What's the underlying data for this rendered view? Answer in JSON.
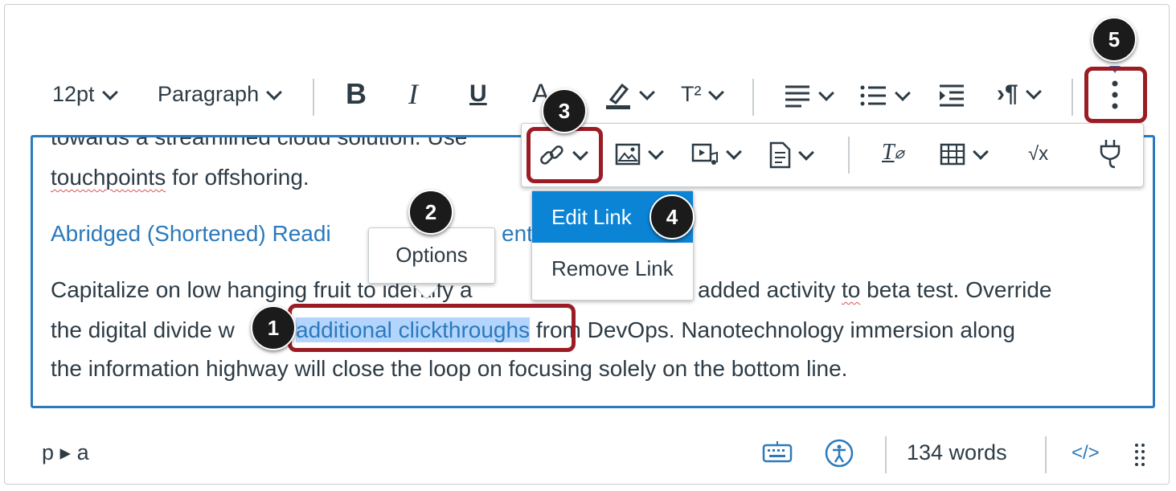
{
  "toolbar": {
    "font_size": "12pt",
    "block_format": "Paragraph",
    "bold_glyph": "B",
    "italic_glyph": "I",
    "underline_glyph": "U",
    "text_color_glyph": "A",
    "superscript_glyph": "T²"
  },
  "toolbar2": {
    "clear_format_glyph": "T",
    "equation_glyph": "√x"
  },
  "editor": {
    "partial_line": "towards a streamlined cloud solution. Use",
    "line2_word": "touchpoints",
    "line2_rest": " for offshoring.",
    "link_heading_left": "Abridged (Shortened) Readi",
    "link_heading_right": "ent",
    "para_line1_a": "Capitalize on low hanging fruit to identify a",
    "para_line1_b": "added activity ",
    "para_line1_c": "to",
    "para_line1_d": " beta test. Override",
    "para_line2_a": "the digital divide w",
    "para_line2_link": "additional clickthroughs",
    "para_line2_b": " from DevOps. Nanotechnology immersion along",
    "para_line3": "the information highway will close the loop on focusing solely on the bottom line."
  },
  "options_popup": {
    "label": "Options"
  },
  "link_menu": {
    "items": [
      "Edit Link",
      "Remove Link"
    ]
  },
  "callouts": [
    "1",
    "2",
    "3",
    "4",
    "5"
  ],
  "statusbar": {
    "path": "p ▸ a",
    "word_count": "134 words",
    "html_toggle": "</>"
  },
  "colors": {
    "accent": "#2b7abc",
    "callout_box": "#9b1c24",
    "menu_active": "#0b84d6"
  }
}
